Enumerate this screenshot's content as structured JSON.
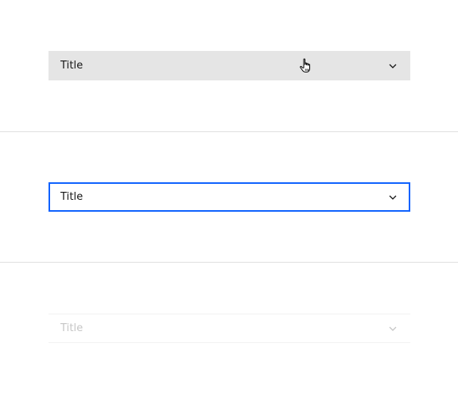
{
  "colors": {
    "hover_background": "#e5e5e5",
    "focus_border": "#0f62fe",
    "text_primary": "#161616",
    "text_disabled": "#c6c6c6",
    "divider": "#e0e0e0"
  },
  "accordions": [
    {
      "state": "hover",
      "title": "Title",
      "icon": "chevron-down-icon"
    },
    {
      "state": "focus",
      "title": "Title",
      "icon": "chevron-down-icon"
    },
    {
      "state": "disabled",
      "title": "Title",
      "icon": "chevron-down-icon"
    }
  ],
  "cursor": {
    "icon": "hand-pointer-icon"
  }
}
